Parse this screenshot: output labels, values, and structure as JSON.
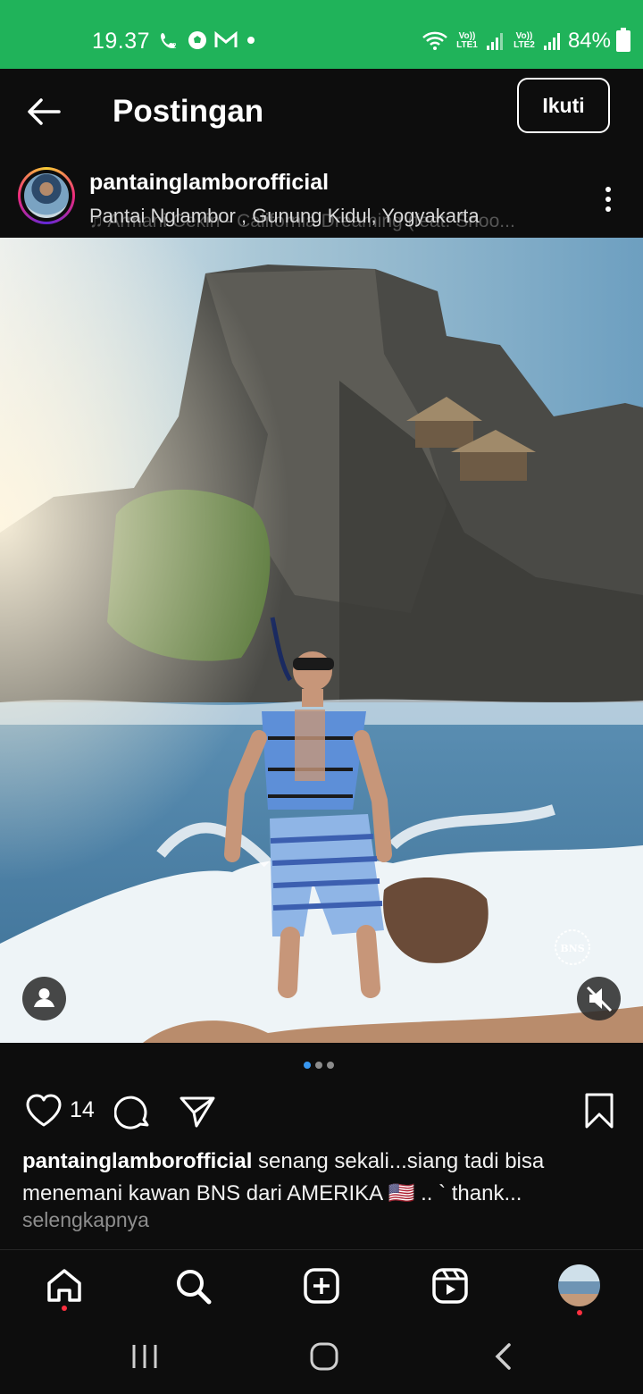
{
  "status_bar": {
    "time": "19.37",
    "battery": "84%",
    "sim1_tag": "Vo)) LTE1",
    "sim2_tag": "Vo)) LTE2",
    "icons": [
      "call-icon",
      "soccer-ball-icon",
      "gmail-icon",
      "dot-icon",
      "wifi-icon",
      "signal-icon",
      "signal-icon",
      "battery-icon"
    ]
  },
  "header": {
    "title": "Postingan",
    "follow_label": "Ikuti"
  },
  "post": {
    "username": "pantainglamborofficial",
    "location": "Pantai Nglambor , Gunung Kidul, Yogyakarta",
    "audio_ghost": "♫ Armani Cekin - California Dreaming (feat. Snoo...",
    "like_count": "14",
    "caption_user": "pantainglamborofficial",
    "caption_text": " senang sekali...siang tadi bisa menemani kawan BNS dari AMERIKA 🇺🇸 .. ` thank...",
    "more_label": "selengkapnya",
    "watermark": "BNS",
    "carousel_pages": 3,
    "carousel_active": 1
  },
  "bottom_nav": [
    "home-icon",
    "search-icon",
    "create-icon",
    "reels-icon",
    "profile-avatar"
  ]
}
